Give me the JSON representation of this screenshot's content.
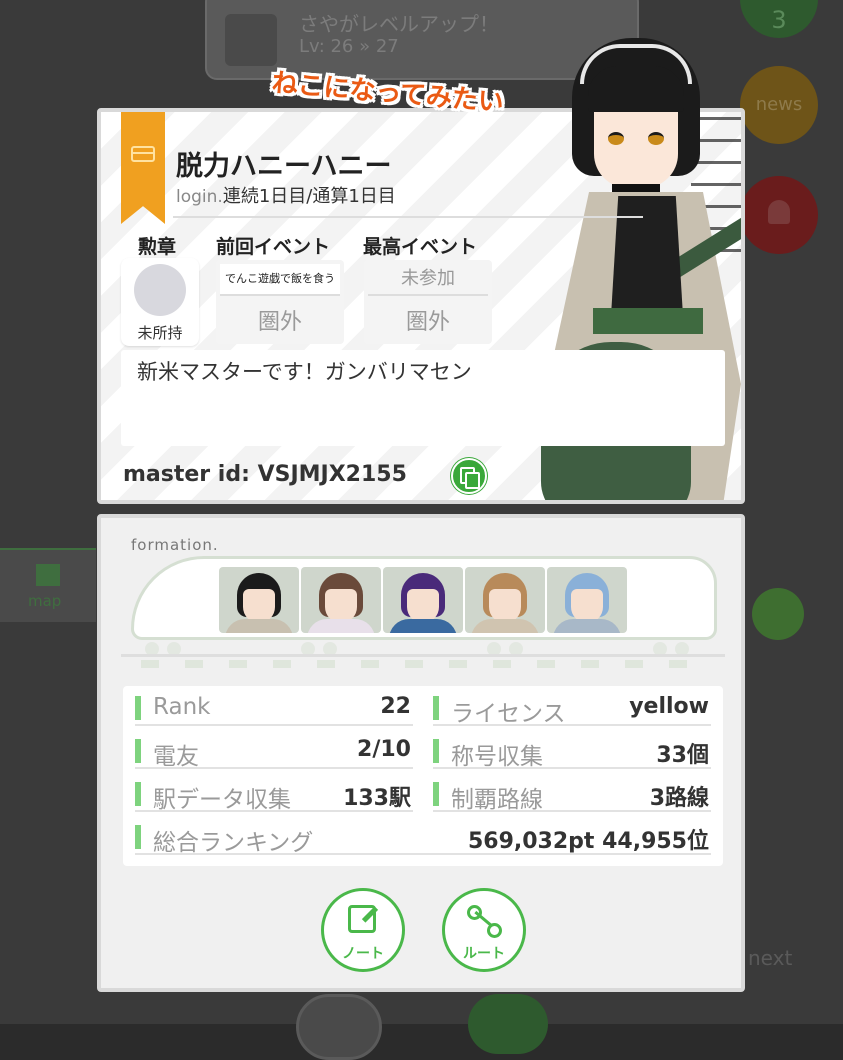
{
  "background": {
    "notice_title": "さやがレベルアップ！",
    "notice_sub": "Lv: 26 » 27",
    "badge_count": "3",
    "news_label": "news",
    "map_label": "map",
    "next_label": "next"
  },
  "speech": "ねこになってみたい",
  "profile": {
    "name": "脱力ハニーハニー",
    "login_prefix": "login.",
    "login_text": "連続1日目/通算1日目",
    "medal_header": "勲章",
    "medal_value": "未所持",
    "last_event_header": "前回イベント",
    "last_event_name": "でんこ遊戯で飯を食う",
    "last_event_rank": "圏外",
    "best_event_header": "最高イベント",
    "best_event_name": "未参加",
    "best_event_rank": "圏外",
    "comment": "新米マスターです！ガンバリマセン",
    "master_id_label": "master id:",
    "master_id": "VSJMJX2155"
  },
  "formation": {
    "label": "formation."
  },
  "stats": {
    "rank_label": "Rank",
    "rank_value": "22",
    "license_label": "ライセンス",
    "license_value": "yellow",
    "friend_label": "電友",
    "friend_value": "2/10",
    "title_label": "称号収集",
    "title_value": "33個",
    "station_label": "駅データ収集",
    "station_value": "133駅",
    "line_label": "制覇路線",
    "line_value": "3路線",
    "ranking_label": "総合ランキング",
    "ranking_value": "569,032pt 44,955位"
  },
  "buttons": {
    "note_label": "ノート",
    "route_label": "ルート"
  },
  "colors": {
    "accent_green": "#4ab84a",
    "ribbon_orange": "#f0a020",
    "speech_orange": "#ea5a14"
  }
}
